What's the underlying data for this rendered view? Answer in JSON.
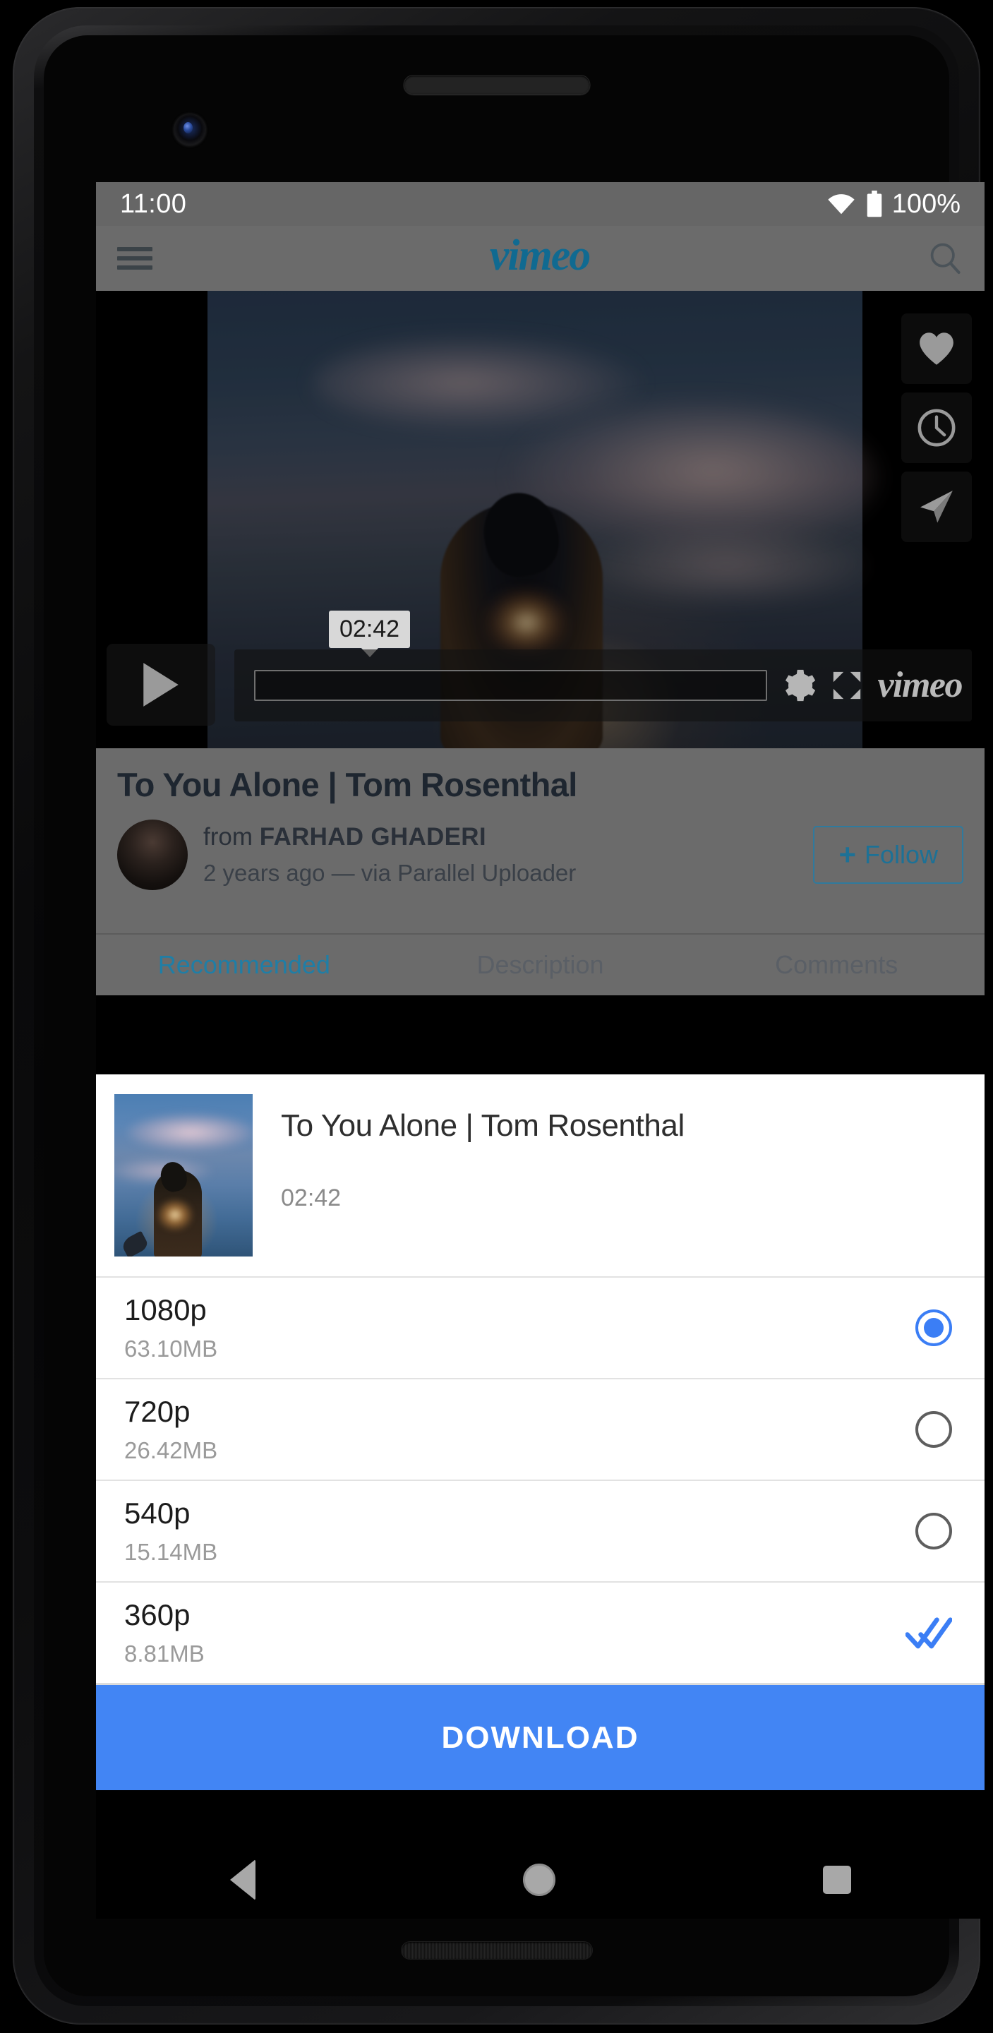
{
  "statusbar": {
    "time": "11:00",
    "battery_percent": "100%",
    "wifi_icon": "wifi-icon",
    "battery_icon": "battery-full-icon"
  },
  "appbar": {
    "menu_icon": "hamburger-menu-icon",
    "logo": "vimeo",
    "search_icon": "search-icon"
  },
  "player": {
    "play_icon": "play-icon",
    "time_tooltip": "02:42",
    "settings_icon": "gear-icon",
    "fullscreen_icon": "fullscreen-icon",
    "brand": "vimeo",
    "side_actions": [
      {
        "name": "like-button",
        "icon": "heart-icon"
      },
      {
        "name": "watch-later-button",
        "icon": "clock-icon"
      },
      {
        "name": "share-button",
        "icon": "paper-plane-icon"
      }
    ]
  },
  "video_info": {
    "title": "To You Alone | Tom Rosenthal",
    "from_prefix": "from ",
    "author": "FARHAD GHADERI",
    "meta": "2 years ago — via Parallel Uploader",
    "follow_label": "Follow",
    "follow_plus": "+"
  },
  "tabs": [
    {
      "label": "Recommended",
      "active": true
    },
    {
      "label": "Description",
      "active": false
    },
    {
      "label": "Comments",
      "active": false
    }
  ],
  "download_dialog": {
    "title": "To You Alone | Tom Rosenthal",
    "duration": "02:42",
    "qualities": [
      {
        "label": "1080p",
        "size": "63.10MB",
        "state": "selected"
      },
      {
        "label": "720p",
        "size": "26.42MB",
        "state": "unselected"
      },
      {
        "label": "540p",
        "size": "15.14MB",
        "state": "unselected"
      },
      {
        "label": "360p",
        "size": "8.81MB",
        "state": "downloaded"
      }
    ],
    "download_button": "DOWNLOAD"
  },
  "navbar": {
    "back_icon": "back-triangle-icon",
    "home_icon": "home-circle-icon",
    "recents_icon": "recents-square-icon"
  },
  "colors": {
    "accent_blue": "#4285f4",
    "vimeo_teal": "#106a91",
    "tab_active": "#1f7ea6",
    "chrome_gray": "#6b6b6b"
  }
}
